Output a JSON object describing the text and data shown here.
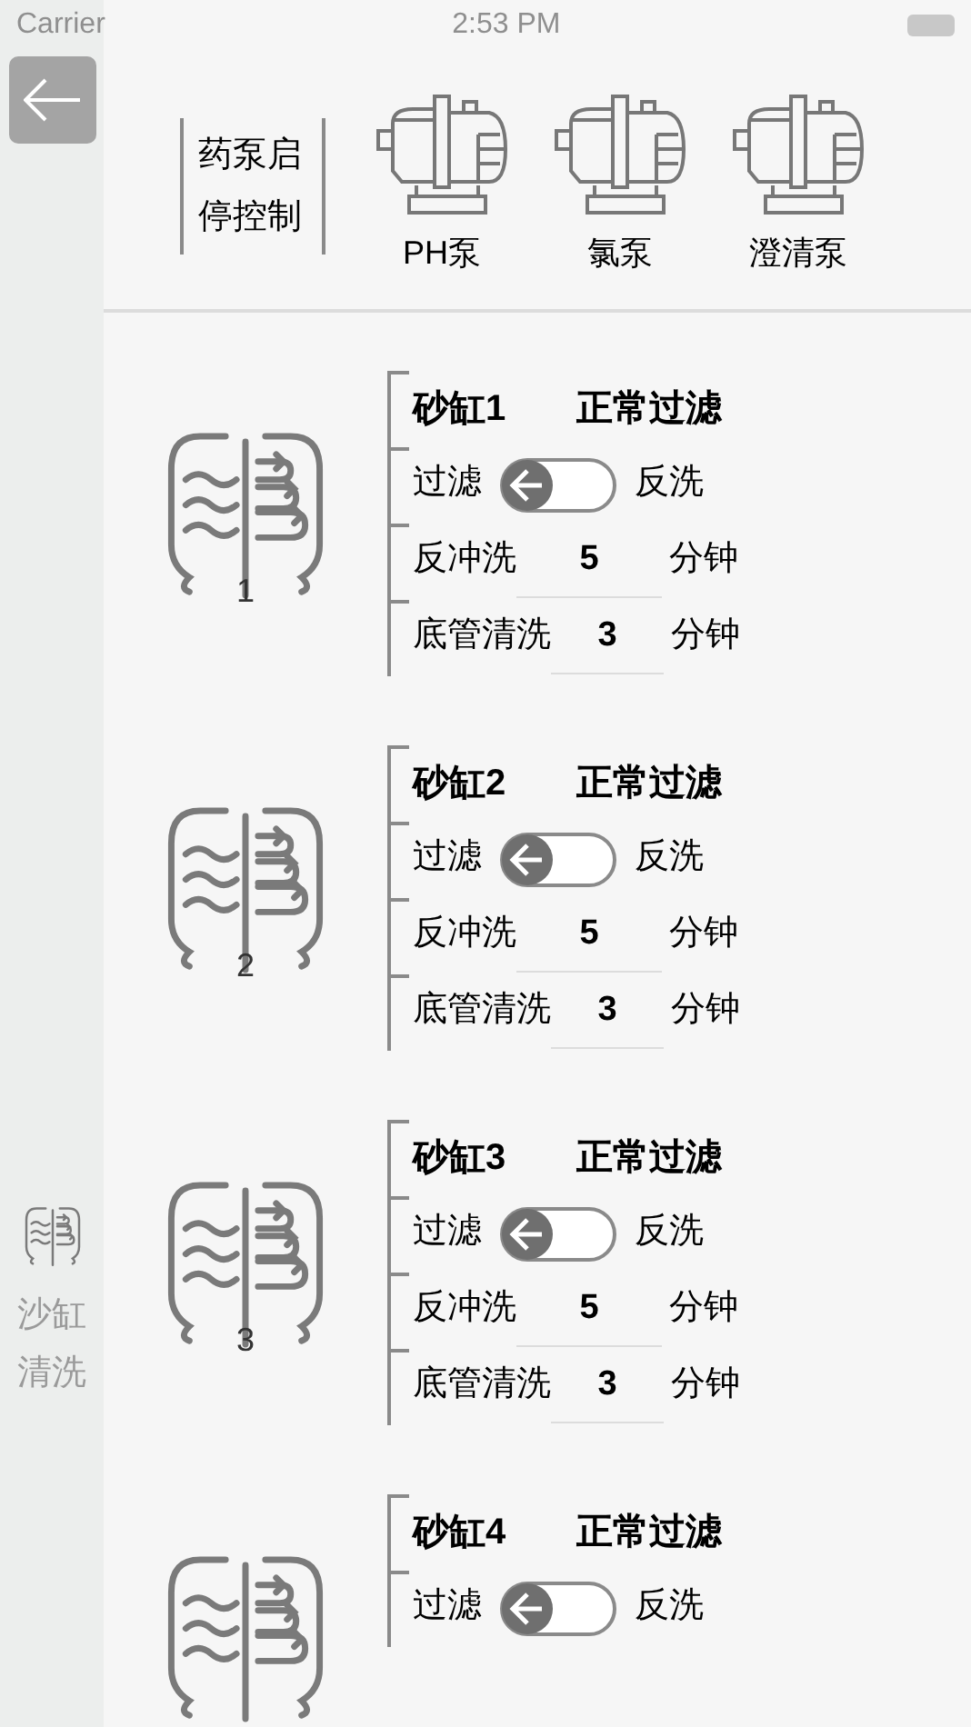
{
  "status_bar": {
    "carrier": "Carrier",
    "time": "2:53 PM"
  },
  "pump_control": {
    "label": "药泵启停控制",
    "pumps": [
      {
        "label": "PH泵"
      },
      {
        "label": "氯泵"
      },
      {
        "label": "澄清泵"
      }
    ]
  },
  "sidebar": {
    "label": "沙缸清洗"
  },
  "filters": [
    {
      "number": "1",
      "title": "砂缸1",
      "status": "正常过滤",
      "left": "过滤",
      "right": "反洗",
      "on": false,
      "rows": [
        {
          "label": "反冲洗",
          "value": "5",
          "unit": "分钟"
        },
        {
          "label": "底管清洗",
          "value": "3",
          "unit": "分钟"
        }
      ]
    },
    {
      "number": "2",
      "title": "砂缸2",
      "status": "正常过滤",
      "left": "过滤",
      "right": "反洗",
      "on": false,
      "rows": [
        {
          "label": "反冲洗",
          "value": "5",
          "unit": "分钟"
        },
        {
          "label": "底管清洗",
          "value": "3",
          "unit": "分钟"
        }
      ]
    },
    {
      "number": "3",
      "title": "砂缸3",
      "status": "正常过滤",
      "left": "过滤",
      "right": "反洗",
      "on": false,
      "rows": [
        {
          "label": "反冲洗",
          "value": "5",
          "unit": "分钟"
        },
        {
          "label": "底管清洗",
          "value": "3",
          "unit": "分钟"
        }
      ]
    },
    {
      "title": "砂缸4",
      "status": "正常过滤",
      "left": "过滤",
      "right": "反洗",
      "on": false
    }
  ]
}
